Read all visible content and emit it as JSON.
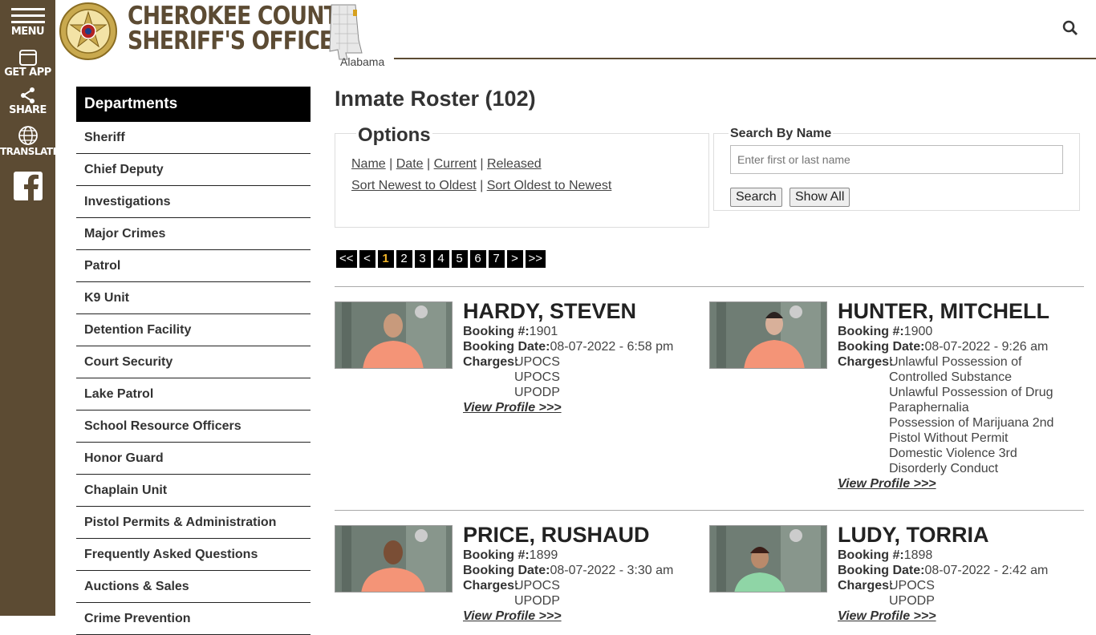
{
  "rail": {
    "menu": "MENU",
    "get_app": "GET APP",
    "share": "SHARE",
    "translate": "TRANSLATE"
  },
  "header": {
    "title_line1": "CHEROKEE COUNTY",
    "title_line2": "SHERIFF'S OFFICE",
    "state": "Alabama"
  },
  "colors": {
    "brand": "#5c4b33",
    "pager_active": "#f0b429"
  },
  "sidebar": {
    "heading": "Departments",
    "items": [
      "Sheriff",
      "Chief Deputy",
      "Investigations",
      "Major Crimes",
      "Patrol",
      "K9 Unit",
      "Detention Facility",
      "Court Security",
      "Lake Patrol",
      "School Resource Officers",
      "Honor Guard",
      "Chaplain Unit",
      "Pistol Permits & Administration",
      "Frequently Asked Questions",
      "Auctions & Sales",
      "Crime Prevention"
    ]
  },
  "main": {
    "title": "Inmate Roster (102)",
    "options": {
      "legend": "Options",
      "sort_name": "Name",
      "sort_date": "Date",
      "sort_current": "Current",
      "sort_released": "Released",
      "sort_new_old": "Sort Newest to Oldest",
      "sort_old_new": "Sort Oldest to Newest",
      "sep": "|"
    },
    "search": {
      "legend": "Search By Name",
      "placeholder": "Enter first or last name",
      "search_button": "Search",
      "show_all_button": "Show All"
    },
    "pager": [
      "<<",
      "<",
      "1",
      "2",
      "3",
      "4",
      "5",
      "6",
      "7",
      ">",
      ">>"
    ],
    "pager_active": "1",
    "labels": {
      "booking_no": "Booking #:",
      "booking_date": "Booking Date:",
      "charges": "Charges:",
      "view_profile": "View Profile >>>"
    },
    "inmates": [
      {
        "name": "HARDY, STEVEN",
        "booking_no": "1901",
        "booking_date": "08-07-2022 - 6:58 pm",
        "charges": [
          "UPOCS",
          "UPOCS",
          "UPODP"
        ]
      },
      {
        "name": "HUNTER, MITCHELL",
        "booking_no": "1900",
        "booking_date": "08-07-2022 - 9:26 am",
        "charges": [
          "Unlawful Possession of",
          "Controlled Substance",
          "Unlawful Possession of Drug",
          "Paraphernalia",
          "Possession of Marijuana 2nd",
          "Pistol Without Permit",
          "Domestic Violence 3rd",
          "Disorderly Conduct"
        ]
      },
      {
        "name": "PRICE, RUSHAUD",
        "booking_no": "1899",
        "booking_date": "08-07-2022 - 3:30 am",
        "charges": [
          "UPOCS",
          "UPODP"
        ]
      },
      {
        "name": "LUDY, TORRIA",
        "booking_no": "1898",
        "booking_date": "08-07-2022 - 2:42 am",
        "charges": [
          "UPOCS",
          "UPODP"
        ]
      }
    ]
  }
}
